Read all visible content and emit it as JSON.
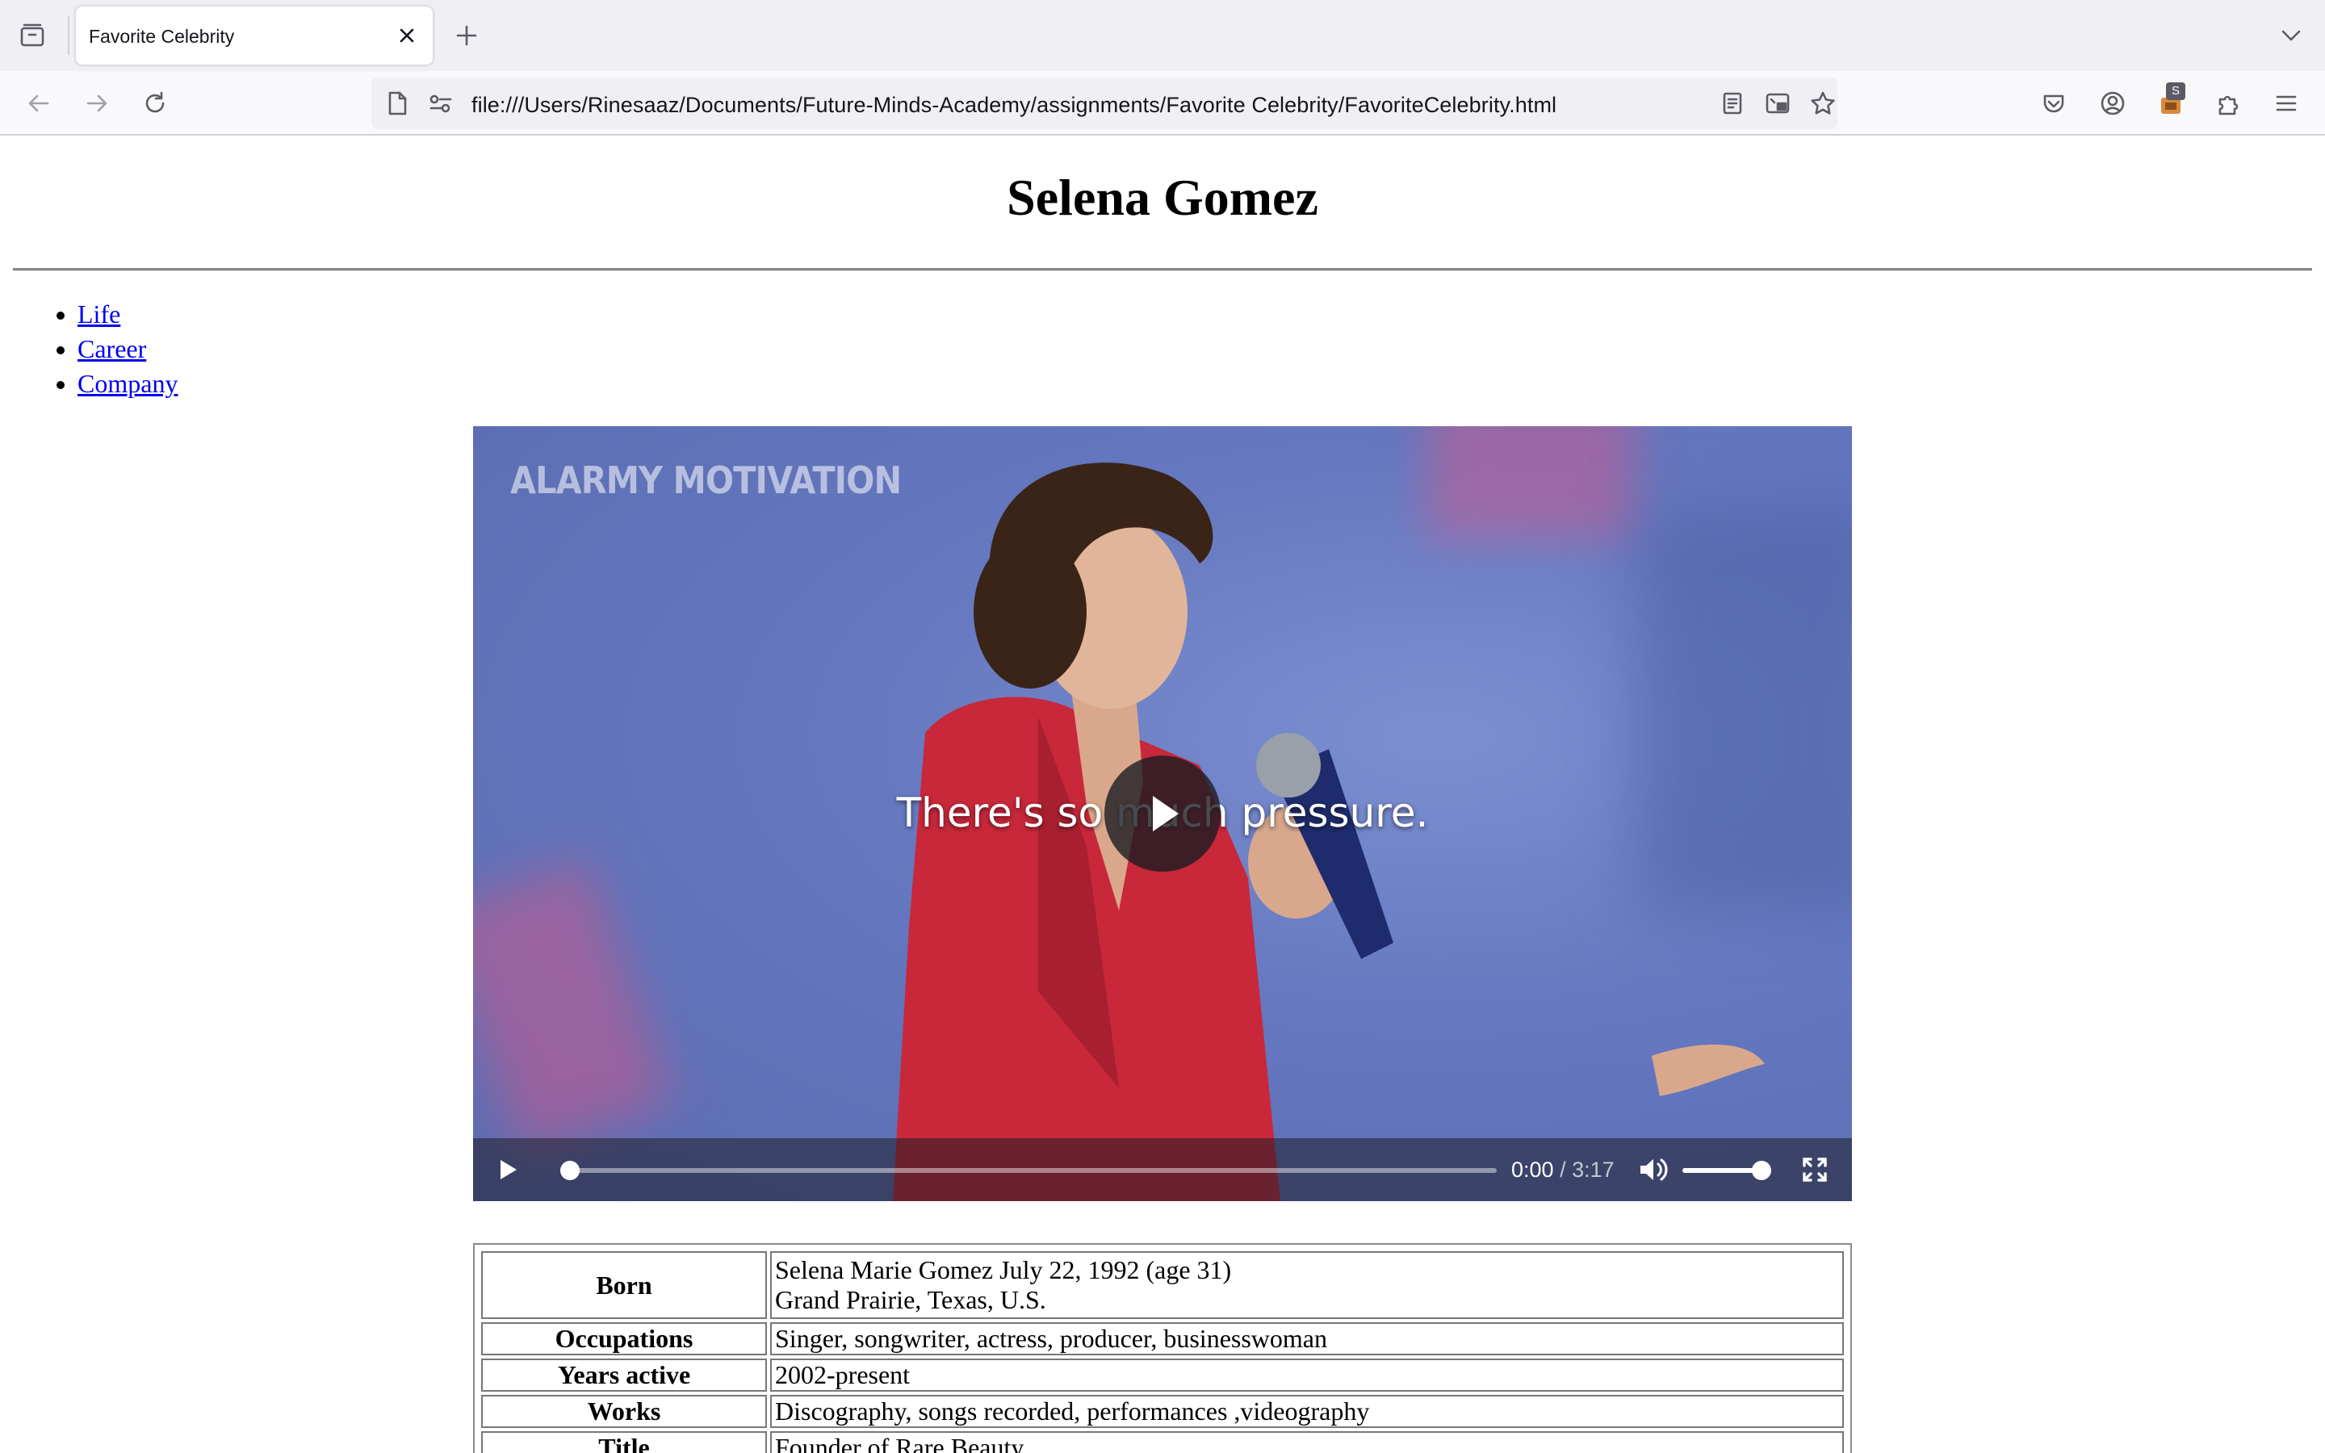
{
  "browser": {
    "tab_title": "Favorite Celebrity",
    "url": "file:///Users/Rinesaaz/Documents/Future-Minds-Academy/assignments/Favorite Celebrity/FavoriteCelebrity.html",
    "extension_badge": "S"
  },
  "page": {
    "title": "Selena Gomez",
    "nav": [
      "Life",
      "Career",
      "Company"
    ]
  },
  "video": {
    "watermark": "ALARMY MOTIVATION",
    "subtitle": "There's so much pressure.",
    "current_time": "0:00",
    "duration": "3:17",
    "progress": 0.0,
    "volume": 1.0,
    "paused": true
  },
  "info": {
    "rows": [
      {
        "key": "Born",
        "value": "Selena Marie Gomez July 22, 1992 (age 31)",
        "value2": "Grand Prairie, Texas, U.S."
      },
      {
        "key": "Occupations",
        "value": "Singer, songwriter, actress, producer, businesswoman"
      },
      {
        "key": "Years active",
        "value": "2002-present"
      },
      {
        "key": "Works",
        "value": "Discography, songs recorded, performances ,videography"
      },
      {
        "key": "Title",
        "value": "Founder of Rare Beauty"
      }
    ]
  }
}
